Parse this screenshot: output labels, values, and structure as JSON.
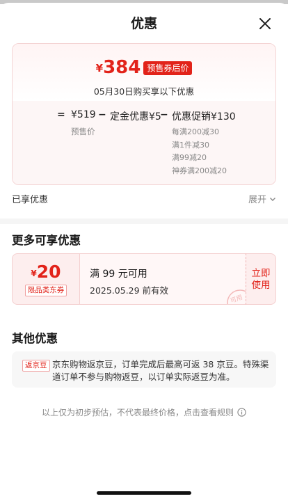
{
  "header": {
    "title": "优惠"
  },
  "summary": {
    "currency": "¥",
    "final_price": "384",
    "tag": "预售券后价",
    "date_line": "05月30日购买享以下优惠",
    "formula": {
      "eq": "=",
      "presale_value": "¥519",
      "minus1": "−",
      "deposit_text": "定金优惠¥5",
      "minus2": "−",
      "promo_text": "优惠促销¥130",
      "presale_label": "预售价",
      "rules": [
        "每满200减30",
        "满1件减30",
        "满99减20",
        "神券满200减20"
      ]
    }
  },
  "enjoyed": {
    "label": "已享优惠",
    "expand": "展开"
  },
  "more": {
    "title": "更多可享优惠",
    "coupon": {
      "currency": "¥",
      "amount": "20",
      "type": "限品类东券",
      "condition": "满 99 元可用",
      "expiry": "2025.05.29 前有效",
      "action_line1": "立即",
      "action_line2": "使用",
      "stamp": "可用"
    }
  },
  "other": {
    "title": "其他优惠",
    "tag": "返京豆",
    "text": "京东购物返京豆，订单完成后最高可返 38 京豆。特殊渠道订单不参与购物返豆，以订单实际返豆为准。"
  },
  "footer": {
    "note": "以上仅为初步预估，不代表最终价格，点击查看规则"
  },
  "colors": {
    "accent": "#e2231a",
    "muted": "#888888"
  }
}
